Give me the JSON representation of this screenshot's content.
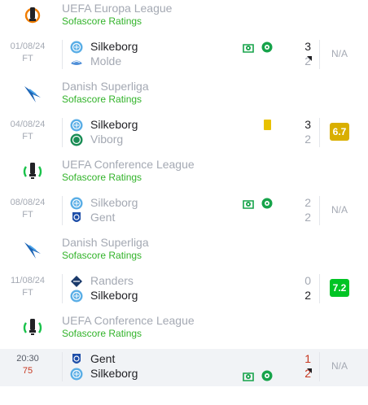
{
  "colors": {
    "rating_yellow": "#d9af00",
    "rating_green": "#00c424",
    "sofascore_green": "#32b32a",
    "live_red": "#c7361f"
  },
  "sections": [
    {
      "tournament": {
        "name": "UEFA Europa League",
        "subtitle": "Sofascore Ratings",
        "logo": "europa-league-logo"
      },
      "match": {
        "date": "01/08/24",
        "status": "FT",
        "home": {
          "name": "Silkeborg",
          "crest": "silkeborg-crest",
          "score": "3"
        },
        "away": {
          "name": "Molde",
          "crest": "molde-crest",
          "score": "2"
        },
        "rating": "N/A"
      }
    },
    {
      "tournament": {
        "name": "Danish Superliga",
        "subtitle": "Sofascore Ratings",
        "logo": "superliga-logo"
      },
      "match": {
        "date": "04/08/24",
        "status": "FT",
        "home": {
          "name": "Silkeborg",
          "crest": "silkeborg-crest",
          "score": "3"
        },
        "away": {
          "name": "Viborg",
          "crest": "viborg-crest",
          "score": "2"
        },
        "rating": "6.7"
      }
    },
    {
      "tournament": {
        "name": "UEFA Conference League",
        "subtitle": "Sofascore Ratings",
        "logo": "conference-league-logo"
      },
      "match": {
        "date": "08/08/24",
        "status": "FT",
        "home": {
          "name": "Silkeborg",
          "crest": "silkeborg-crest",
          "score": "2"
        },
        "away": {
          "name": "Gent",
          "crest": "gent-crest",
          "score": "2"
        },
        "rating": "N/A"
      }
    },
    {
      "tournament": {
        "name": "Danish Superliga",
        "subtitle": "Sofascore Ratings",
        "logo": "superliga-logo"
      },
      "match": {
        "date": "11/08/24",
        "status": "FT",
        "home": {
          "name": "Randers",
          "crest": "randers-crest",
          "score": "0"
        },
        "away": {
          "name": "Silkeborg",
          "crest": "silkeborg-crest",
          "score": "2"
        },
        "rating": "7.2"
      }
    },
    {
      "tournament": {
        "name": "UEFA Conference League",
        "subtitle": "Sofascore Ratings",
        "logo": "conference-league-logo"
      },
      "match": {
        "date": "20:30",
        "status": "75",
        "home": {
          "name": "Gent",
          "crest": "gent-crest",
          "score": "1"
        },
        "away": {
          "name": "Silkeborg",
          "crest": "silkeborg-crest",
          "score": "2"
        },
        "rating": "N/A"
      }
    }
  ]
}
